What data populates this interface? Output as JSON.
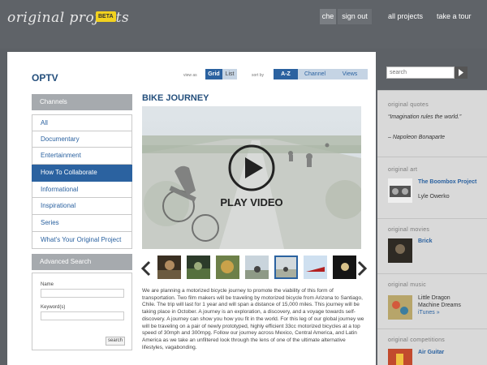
{
  "header": {
    "logo": "original projects",
    "beta": "BETA",
    "user": "che",
    "signout": "sign out",
    "all_projects": "all projects",
    "take_tour": "take a tour"
  },
  "main": {
    "title": "OPTV",
    "view_as_label": "view as",
    "view_grid": "Grid",
    "view_list": "List",
    "sort_by_label": "sort by",
    "sort_az": "A-Z",
    "sort_channel": "Channel",
    "sort_views": "Views"
  },
  "channels": {
    "heading": "Channels",
    "items": [
      "All",
      "Documentary",
      "Entertainment",
      "How To Collaborate",
      "Informational",
      "Inspirational",
      "Series",
      "What's Your Original Project"
    ],
    "active_index": 3
  },
  "advanced_search": {
    "heading": "Advanced Search",
    "name_label": "Name",
    "keywords_label": "Keyword(s)",
    "button": "search"
  },
  "video": {
    "title": "BIKE JOURNEY",
    "play_label": "PLAY VIDEO",
    "description": "We are planning a motorized bicycle journey to promote the viability of this form of transportation. Two film makers will be traveling by motorized bicycle from Arizona to Santiago, Chile. The trip will last for 1 year and will span a distance of 15,000 miles. This journey will be taking place in October. A journey is an exploration, a discovery, and a voyage towards self-discovery. A journey can show you how you fit in the world. For this leg of our global journey we will be traveling on a pair of newly prototyped, highly efficient 33cc motorized bicycles at a top speed of 30mph and 300mpg. Follow our journey across Mexico, Central America, and Latin America as we take an unfiltered look through the lens of one of the ultimate alternative lifestyles, vagabonding.",
    "selected_thumb_index": 4
  },
  "sidebar": {
    "search_placeholder": "search",
    "quotes_title": "original quotes",
    "quote_text": "“Imagination rules the world.”",
    "quote_author": "– Napoleon Bonaparte",
    "art_title": "original art",
    "art_link": "The Boombox Project",
    "art_author": "Lyle Owerko",
    "movies_title": "original movies",
    "movies_link": "Brick",
    "music_title": "original music",
    "music_artist": "Little Dragon",
    "music_album": "Machine Dreams",
    "music_store": "iTunes »",
    "competitions_title": "original competitions",
    "competitions_link": "Air Guitar"
  },
  "colors": {
    "accent": "#2b62a0",
    "beta": "#f2d21f",
    "topbar": "#5f6368",
    "sidebar": "#d9d9d9"
  },
  "icons": {
    "play": "play-icon",
    "prev": "chevron-left-icon",
    "next": "chevron-right-icon",
    "search": "arrow-right-icon"
  }
}
